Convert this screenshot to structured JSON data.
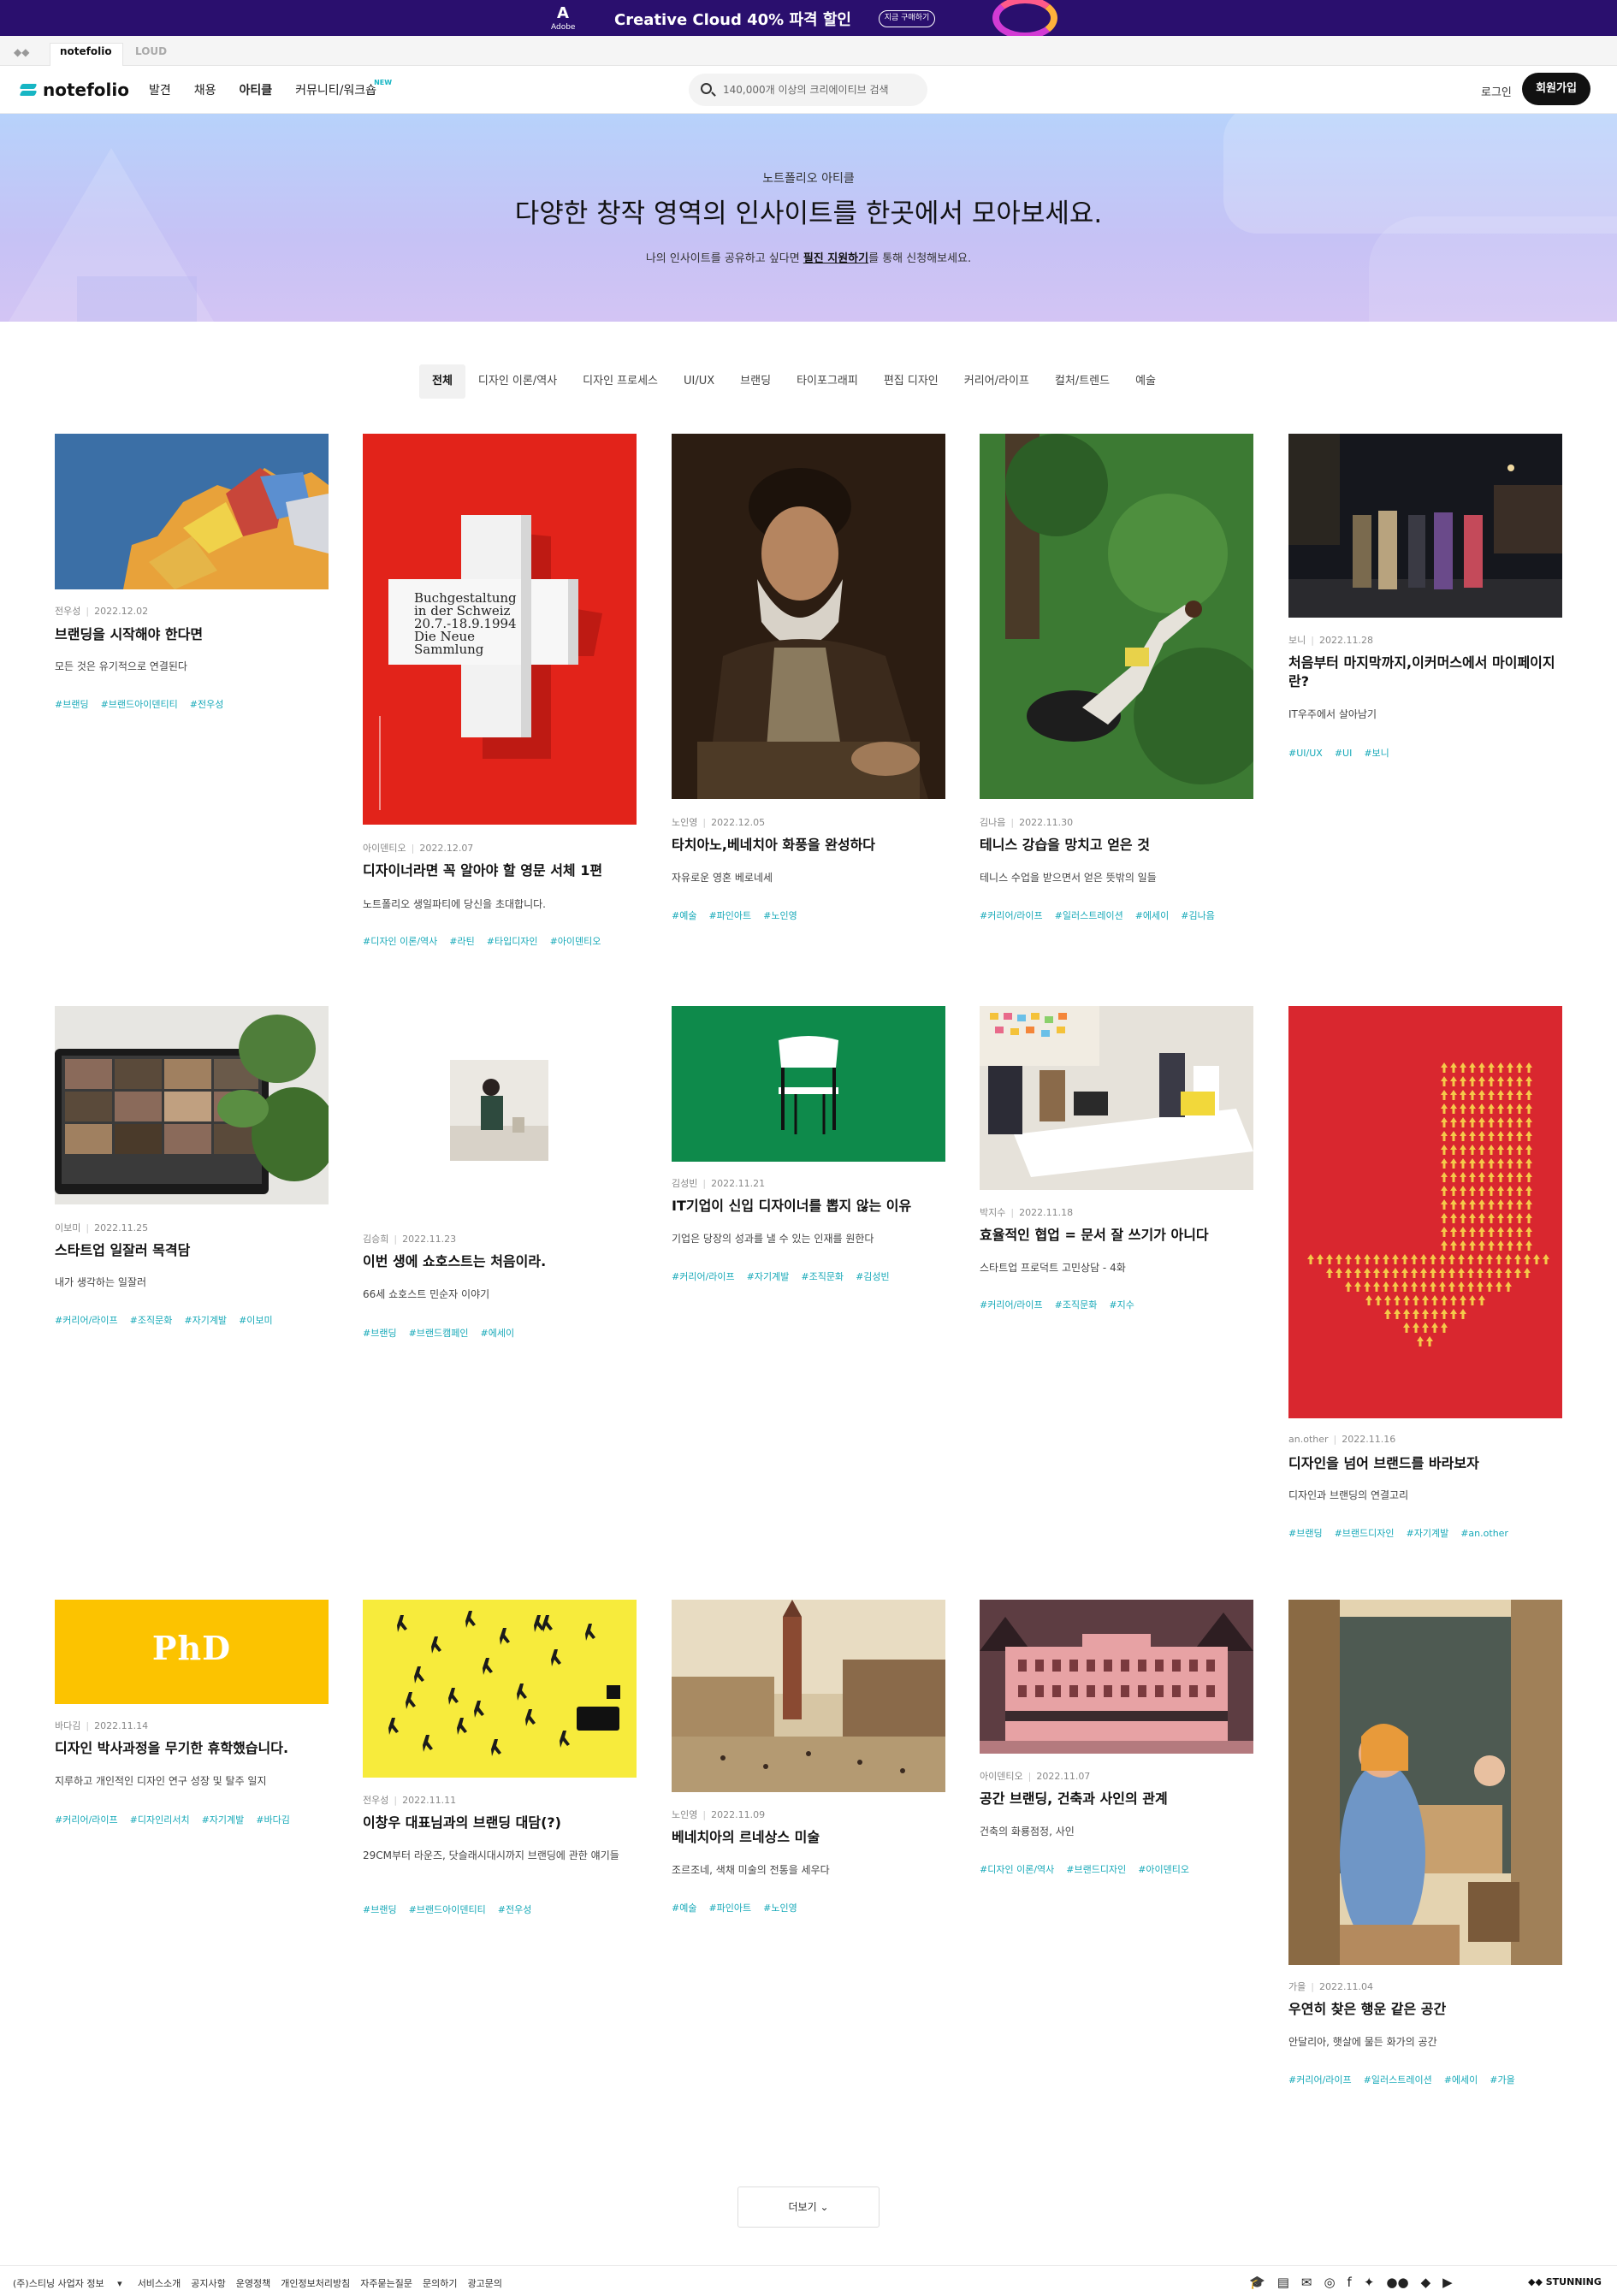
{
  "banner": {
    "adobe_mark": "A",
    "adobe_label": "Adobe",
    "headline": "Creative Cloud 40% 파격 할인",
    "cta": "지금 구매하기"
  },
  "switcher": {
    "active": "notefolio",
    "other": "LOUD"
  },
  "nav": {
    "logo": "notefolio",
    "menu": [
      "발견",
      "채용",
      "아티클",
      "커뮤니티/워크숍"
    ],
    "new_badge": "NEW",
    "search_placeholder": "140,000개 이상의 크리에이티브 검색",
    "login": "로그인",
    "signup": "회원가입"
  },
  "hero": {
    "kicker": "노트폴리오 아티클",
    "title": "다양한 창작 영역의 인사이트를 한곳에서 모아보세요.",
    "desc_pre": "나의 인사이트를 공유하고 싶다면 ",
    "desc_link": "필진 지원하기",
    "desc_post": "를 통해 신청해보세요."
  },
  "filters": [
    "전체",
    "디자인 이론/역사",
    "디자인 프로세스",
    "UI/UX",
    "브랜딩",
    "타이포그래피",
    "편집 디자인",
    "커리어/라이프",
    "컬처/트렌드",
    "예술"
  ],
  "cards": [
    {
      "author": "전우성",
      "date": "2022.12.02",
      "title": "브랜딩을 시작해야 한다면",
      "subtitle": "모든 것은 유기적으로 연결된다",
      "tags": [
        "#브랜딩",
        "#브랜드아이덴티티",
        "#전우성"
      ]
    },
    {
      "author": "아이덴티오",
      "date": "2022.12.07",
      "title": "디자이너라면 꼭 알아야 할 영문 서체 1편",
      "subtitle": "노트폴리오 생일파티에 당신을 초대합니다.",
      "tags": [
        "#디자인 이론/역사",
        "#라틴",
        "#타입디자인",
        "#아이덴티오"
      ]
    },
    {
      "author": "노인영",
      "date": "2022.12.05",
      "title": "타치아노,베네치아 화풍을 완성하다",
      "subtitle": "자유로운 영혼 베로네세",
      "tags": [
        "#예술",
        "#파인아트",
        "#노인영"
      ]
    },
    {
      "author": "김나음",
      "date": "2022.11.30",
      "title": "테니스 강습을 망치고 얻은 것",
      "subtitle": "테니스 수업을 받으면서 얻은 뜻밖의 일들",
      "tags": [
        "#커리어/라이프",
        "#일러스트레이션",
        "#에세이",
        "#김나음"
      ]
    },
    {
      "author": "보니",
      "date": "2022.11.28",
      "title": "처음부터 마지막까지,이커머스에서 마이페이지란?",
      "subtitle": "IT우주에서 살아남기",
      "tags": [
        "#UI/UX",
        "#UI",
        "#보니"
      ]
    },
    {
      "author": "이보미",
      "date": "2022.11.25",
      "title": "스타트업 일잘러 목격담",
      "subtitle": "내가 생각하는 일잘러",
      "tags": [
        "#커리어/라이프",
        "#조직문화",
        "#자기계발",
        "#이보미"
      ]
    },
    {
      "author": "김승희",
      "date": "2022.11.23",
      "title": "이번 생에 쇼호스트는 처음이라.",
      "subtitle": "66세 쇼호스트 민순자 이야기",
      "tags": [
        "#브랜딩",
        "#브랜드캠페인",
        "#에세이"
      ]
    },
    {
      "author": "김성빈",
      "date": "2022.11.21",
      "title": "IT기업이 신입 디자이너를 뽑지 않는 이유",
      "subtitle": "기업은 당장의 성과를 낼 수 있는 인재를 원한다",
      "tags": [
        "#커리어/라이프",
        "#자기계발",
        "#조직문화",
        "#김성빈"
      ]
    },
    {
      "author": "박지수",
      "date": "2022.11.18",
      "title": "효율적인 협업 = 문서 잘 쓰기가 아니다",
      "subtitle": "스타트업 프로덕트 고민상담 - 4화",
      "tags": [
        "#커리어/라이프",
        "#조직문화",
        "#지수"
      ]
    },
    {
      "author": "an.other",
      "date": "2022.11.16",
      "title": "디자인을 넘어 브랜드를 바라보자",
      "subtitle": "디자인과 브랜딩의 연결고리",
      "tags": [
        "#브랜딩",
        "#브랜드디자인",
        "#자기계발",
        "#an.other"
      ]
    },
    {
      "author": "바다김",
      "date": "2022.11.14",
      "title": "디자인 박사과정을 무기한 휴학했습니다.",
      "subtitle": "지루하고 개인적인 디자인 연구 성장 및 탈주 일지",
      "tags": [
        "#커리어/라이프",
        "#디자인리서치",
        "#자기계발",
        "#바다김"
      ]
    },
    {
      "author": "전우성",
      "date": "2022.11.11",
      "title": "이창우 대표님과의 브랜딩 대담(?)",
      "subtitle": "29CM부터 라운즈, 닷슬래시대시까지 브랜딩에 관한 얘기들",
      "tags": [
        "#브랜딩",
        "#브랜드아이덴티티",
        "#전우성"
      ]
    },
    {
      "author": "노인영",
      "date": "2022.11.09",
      "title": "베네치아의 르네상스 미술",
      "subtitle": "조르조네, 색채 미술의 전통을 세우다",
      "tags": [
        "#예술",
        "#파인아트",
        "#노인영"
      ]
    },
    {
      "author": "아이덴티오",
      "date": "2022.11.07",
      "title": "공간 브랜딩, 건축과 사인의 관계",
      "subtitle": "건축의 화룡점정, 사인",
      "tags": [
        "#디자인 이론/역사",
        "#브랜드디자인",
        "#아이덴티오"
      ]
    },
    {
      "author": "가을",
      "date": "2022.11.04",
      "title": "우연히 찾은 행운 같은 공간",
      "subtitle": "안달리아, 햇살에 물든 화가의 공간",
      "tags": [
        "#커리어/라이프",
        "#일러스트레이션",
        "#에세이",
        "#가을"
      ]
    }
  ],
  "poster_text": [
    "Buchgestaltung",
    "in der Schweiz",
    "20.7.-18.9.1994",
    "Die Neue",
    "Sammlung"
  ],
  "phd_text": "PhD",
  "more_label": "더보기",
  "footer": {
    "business": "(주)스티닝 사업자 정보",
    "links": [
      "서비스소개",
      "공지사항",
      "운영정책",
      "개인정보처리방침",
      "자주묻는질문",
      "문의하기",
      "광고문의"
    ],
    "brand": "STUNNING"
  },
  "colors": {
    "accent": "#17b6c4",
    "banner": "#2a0f6e",
    "signup": "#111111"
  }
}
